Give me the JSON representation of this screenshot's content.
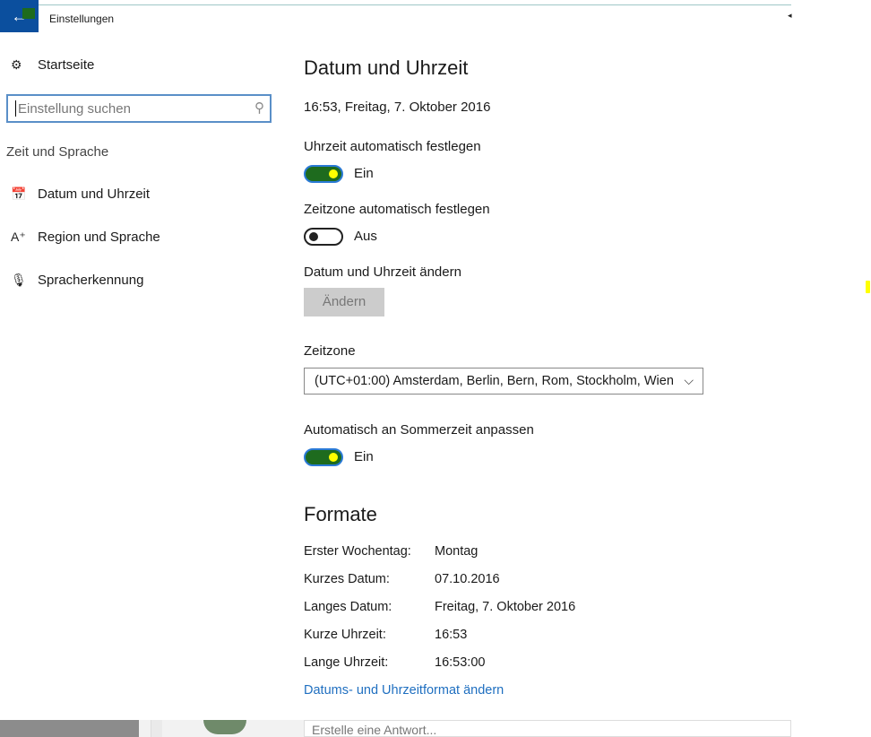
{
  "window": {
    "title": "Einstellungen",
    "back_icon": "back-arrow-icon"
  },
  "sidebar": {
    "home": {
      "label": "Startseite",
      "icon": "gear-icon"
    },
    "search": {
      "placeholder": "Einstellung suchen",
      "icon": "search-icon"
    },
    "group": "Zeit und Sprache",
    "items": [
      {
        "label": "Datum und Uhrzeit",
        "icon": "calendar-clock-icon",
        "selected": true
      },
      {
        "label": "Region und Sprache",
        "icon": "language-icon"
      },
      {
        "label": "Spracherkennung",
        "icon": "microphone-icon"
      }
    ]
  },
  "main": {
    "heading": "Datum und Uhrzeit",
    "current_time": "16:53, Freitag, 7. Oktober 2016",
    "auto_time": {
      "label": "Uhrzeit automatisch festlegen",
      "state": "Ein",
      "on": true
    },
    "auto_zone": {
      "label": "Zeitzone automatisch festlegen",
      "state": "Aus",
      "on": false
    },
    "change": {
      "label": "Datum und Uhrzeit ändern",
      "button": "Ändern"
    },
    "timezone": {
      "label": "Zeitzone",
      "value": "(UTC+01:00) Amsterdam, Berlin, Bern, Rom, Stockholm, Wien"
    },
    "dst": {
      "label": "Automatisch an Sommerzeit anpassen",
      "state": "Ein",
      "on": true
    },
    "formats": {
      "heading": "Formate",
      "rows": [
        {
          "key": "Erster Wochentag:",
          "value": "Montag"
        },
        {
          "key": "Kurzes Datum:",
          "value": "07.10.2016"
        },
        {
          "key": "Langes Datum:",
          "value": "Freitag, 7. Oktober 2016"
        },
        {
          "key": "Kurze Uhrzeit:",
          "value": "16:53"
        },
        {
          "key": "Lange Uhrzeit:",
          "value": "16:53:00"
        }
      ],
      "link": "Datums- und Uhrzeitformat ändern"
    }
  },
  "background": {
    "reply_placeholder": "Erstelle eine Antwort..."
  },
  "colors": {
    "highlight": "#ffff00",
    "accent": "#0b4f9e",
    "toggle_on": "#1e6b1e",
    "link": "#1f6fc0"
  }
}
